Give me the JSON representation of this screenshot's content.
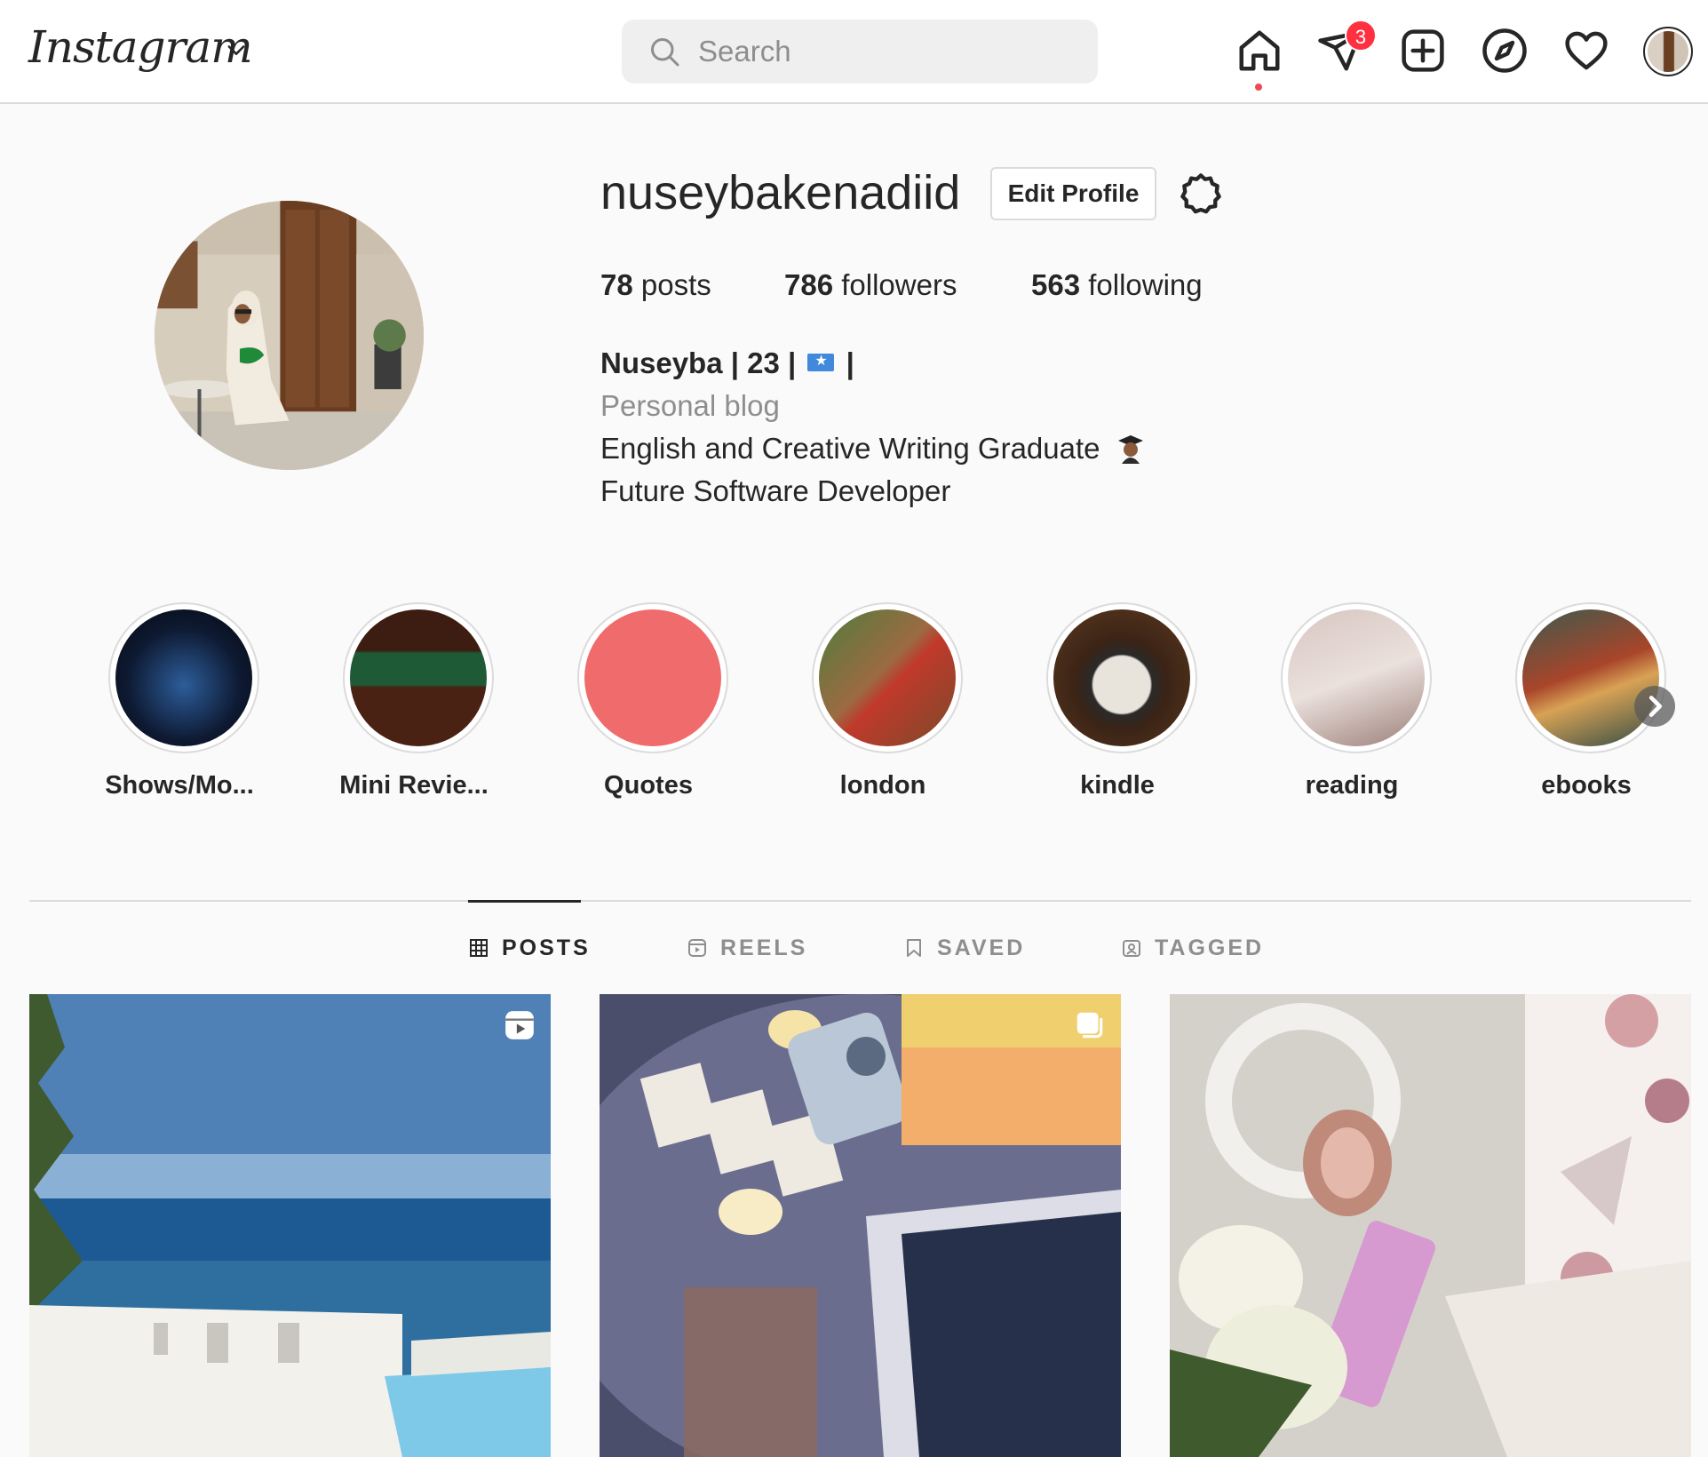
{
  "nav": {
    "logo": "Instagram",
    "search_placeholder": "Search",
    "messages_badge": "3",
    "icons": [
      "home-icon",
      "direct-messages-icon",
      "new-post-icon",
      "explore-icon",
      "activity-heart-icon",
      "profile-avatar"
    ]
  },
  "profile": {
    "username": "nuseybakenadiid",
    "edit_profile_label": "Edit Profile",
    "stats": [
      {
        "count": "78",
        "label": "posts"
      },
      {
        "count": "786",
        "label": "followers"
      },
      {
        "count": "563",
        "label": "following"
      }
    ],
    "bio": {
      "name_pre": "Nuseyba | 23 |",
      "name_post": "|",
      "category": "Personal blog",
      "line1": "English and Creative Writing Graduate",
      "line2": "Future Software Developer"
    }
  },
  "highlights": [
    {
      "label": "Shows/Mo..."
    },
    {
      "label": "Mini Revie..."
    },
    {
      "label": "Quotes"
    },
    {
      "label": "london"
    },
    {
      "label": "kindle"
    },
    {
      "label": "reading"
    },
    {
      "label": "ebooks"
    }
  ],
  "tabs": [
    {
      "label": "POSTS",
      "active": true
    },
    {
      "label": "REELS",
      "active": false
    },
    {
      "label": "SAVED",
      "active": false
    },
    {
      "label": "TAGGED",
      "active": false
    }
  ],
  "posts": [
    {
      "type": "reel"
    },
    {
      "type": "carousel"
    },
    {
      "type": "image"
    }
  ],
  "colors": {
    "badge": "#ff3040",
    "text": "#262626",
    "secondary": "#8e8e8e",
    "border": "#dbdbdb"
  }
}
